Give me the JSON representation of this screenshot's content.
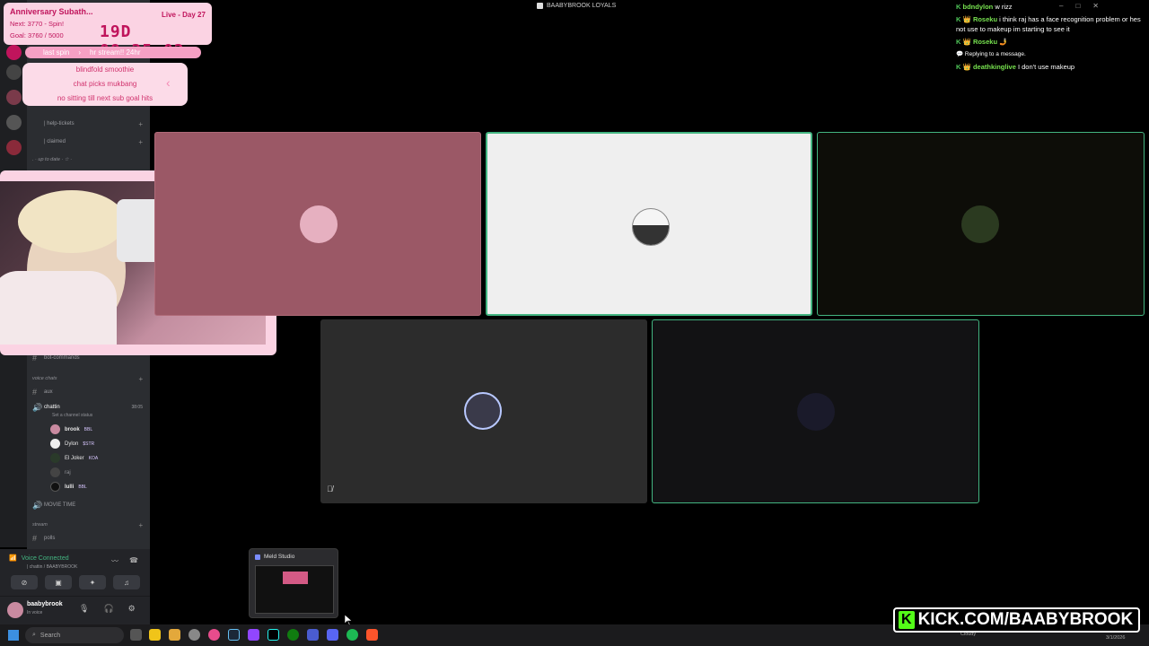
{
  "window": {
    "title": "BAABYBROOK LOYALS"
  },
  "overlay": {
    "title": "Anniversary Subath...",
    "live_day": "Live - Day 27",
    "next": "Next: 3770 - Spin!",
    "goal": "Goal: 3760 / 5000",
    "timer": "19D 08:25:02",
    "last_spin": "last spin",
    "hr_stream": "hr stream!! 24hr",
    "goals": [
      "blindfold smoothie",
      "chat picks mukbang",
      "no sitting till next sub goal hits"
    ]
  },
  "discord": {
    "channels": [
      {
        "label": "| help-tickets",
        "kind": "text"
      },
      {
        "label": "| claimed",
        "kind": "text"
      },
      {
        "label": ". · up to date · ☆ ·",
        "kind": "category"
      },
      {
        "label": "bot-commands",
        "kind": "text"
      },
      {
        "label": "voice chats",
        "kind": "category"
      },
      {
        "label": "aux",
        "kind": "voice"
      },
      {
        "label": "chattin",
        "kind": "voice"
      },
      {
        "label": "MOVIE TIME",
        "kind": "voice"
      },
      {
        "label": "stream",
        "kind": "category"
      },
      {
        "label": "polls",
        "kind": "text"
      }
    ],
    "channel_status": "Set a channel status",
    "call_time": "38:05",
    "voice_users": [
      {
        "name": "brook",
        "tag": "BBL"
      },
      {
        "name": "Dylon",
        "tag": "$STR"
      },
      {
        "name": "El Joker",
        "tag": "KOA"
      },
      {
        "name": "raj",
        "tag": ""
      },
      {
        "name": "lulli",
        "tag": "BBL"
      }
    ],
    "voice_panel": {
      "status": "Voice Connected",
      "detail": "| chattin / BAABYBROOK"
    },
    "user": {
      "name": "baabybrook",
      "status": "In voice"
    }
  },
  "chat": [
    {
      "name": "bdndylon",
      "text": "w rizz"
    },
    {
      "name": "Roseku",
      "text": "i think raj has a face recognition problem or hes not use to makeup im starting to see it"
    },
    {
      "name": "Roseku",
      "text": ""
    },
    {
      "name": "",
      "text": "Replying to a message."
    },
    {
      "name": "deathkinglive",
      "text": "I don't use makeup"
    }
  ],
  "taskbar": {
    "search_placeholder": "Search",
    "preview_title": "Meld Studio",
    "weather": "Cloudy",
    "date": "3/1/2026"
  },
  "kick": {
    "label": "KICK.COM/BAABYBROOK"
  },
  "colors": {
    "discord_bg": "#2b2d31",
    "overlay_pink": "#fbd3e3",
    "speaking_green": "#43b581",
    "kick_green": "#53fc18"
  }
}
